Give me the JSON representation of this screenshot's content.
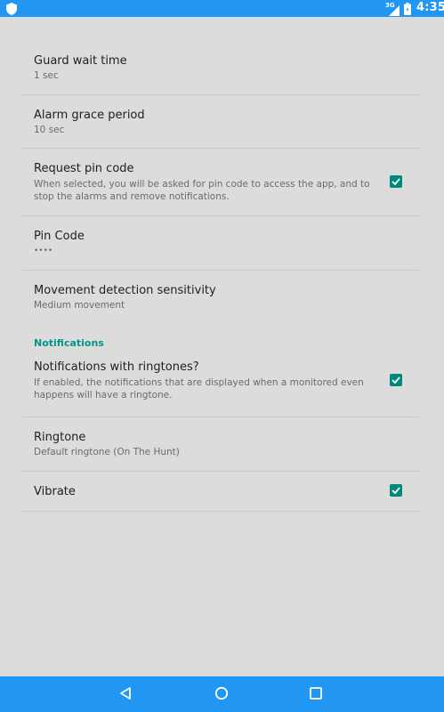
{
  "status": {
    "network": "3G",
    "time": "4:35"
  },
  "prefs": {
    "guard_wait": {
      "title": "Guard wait time",
      "summary": "1 sec"
    },
    "alarm_grace": {
      "title": "Alarm grace period",
      "summary": "10 sec"
    },
    "request_pin": {
      "title": "Request pin code",
      "summary": "When selected, you will be asked for pin code to access the app, and to stop the alarms and remove notifications.",
      "checked": true
    },
    "pin_code": {
      "title": "Pin Code",
      "summary": "••••"
    },
    "movement": {
      "title": "Movement detection sensitivity",
      "summary": "Medium movement"
    },
    "notifications_category": "Notifications",
    "ringtones": {
      "title": "Notifications with ringtones?",
      "summary": "If enabled, the notifications that are displayed when a monitored even happens will have a ringtone.",
      "checked": true
    },
    "ringtone": {
      "title": "Ringtone",
      "summary": "Default ringtone (On The Hunt)"
    },
    "vibrate": {
      "title": "Vibrate",
      "checked": true
    }
  },
  "colors": {
    "accent": "#00897b",
    "bar": "#2196f3",
    "background": "#dcdcdc"
  },
  "nav": {
    "back": "back-icon",
    "home": "home-icon",
    "recents": "recents-icon"
  }
}
